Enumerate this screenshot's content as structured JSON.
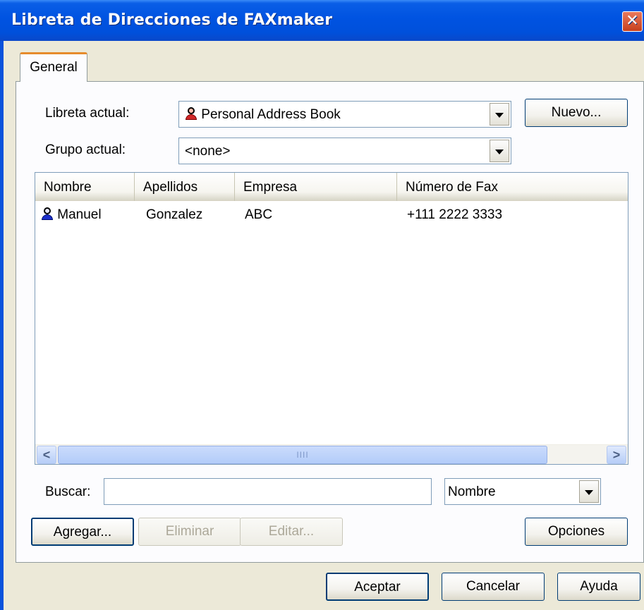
{
  "window": {
    "title": "Libreta de Direcciones de FAXmaker",
    "close_glyph": "✕"
  },
  "tabs": [
    {
      "label": "General"
    }
  ],
  "form": {
    "libreta_label": "Libreta actual:",
    "libreta_value": "Personal Address Book",
    "libreta_icon": "person-red-icon",
    "grupo_label": "Grupo actual:",
    "grupo_value": "<none>",
    "nuevo_button": "Nuevo..."
  },
  "list": {
    "columns": [
      "Nombre",
      "Apellidos",
      "Empresa",
      "Número de Fax"
    ],
    "rows": [
      {
        "icon": "person-blue-icon",
        "nombre": "Manuel",
        "apellidos": "Gonzalez",
        "empresa": "ABC",
        "fax": "+111 2222 3333"
      }
    ],
    "scroll_left": "<",
    "scroll_right": ">",
    "scroll_grip": "IIII"
  },
  "search": {
    "label": "Buscar:",
    "value": "",
    "field_value": "Nombre"
  },
  "actions": {
    "agregar": "Agregar...",
    "eliminar": "Eliminar",
    "editar": "Editar...",
    "opciones": "Opciones"
  },
  "dialog_buttons": {
    "aceptar": "Aceptar",
    "cancelar": "Cancelar",
    "ayuda": "Ayuda"
  },
  "colors": {
    "title_bar": "#0053e1",
    "tab_accent": "#e68b2c",
    "close_button": "#c8401e"
  }
}
